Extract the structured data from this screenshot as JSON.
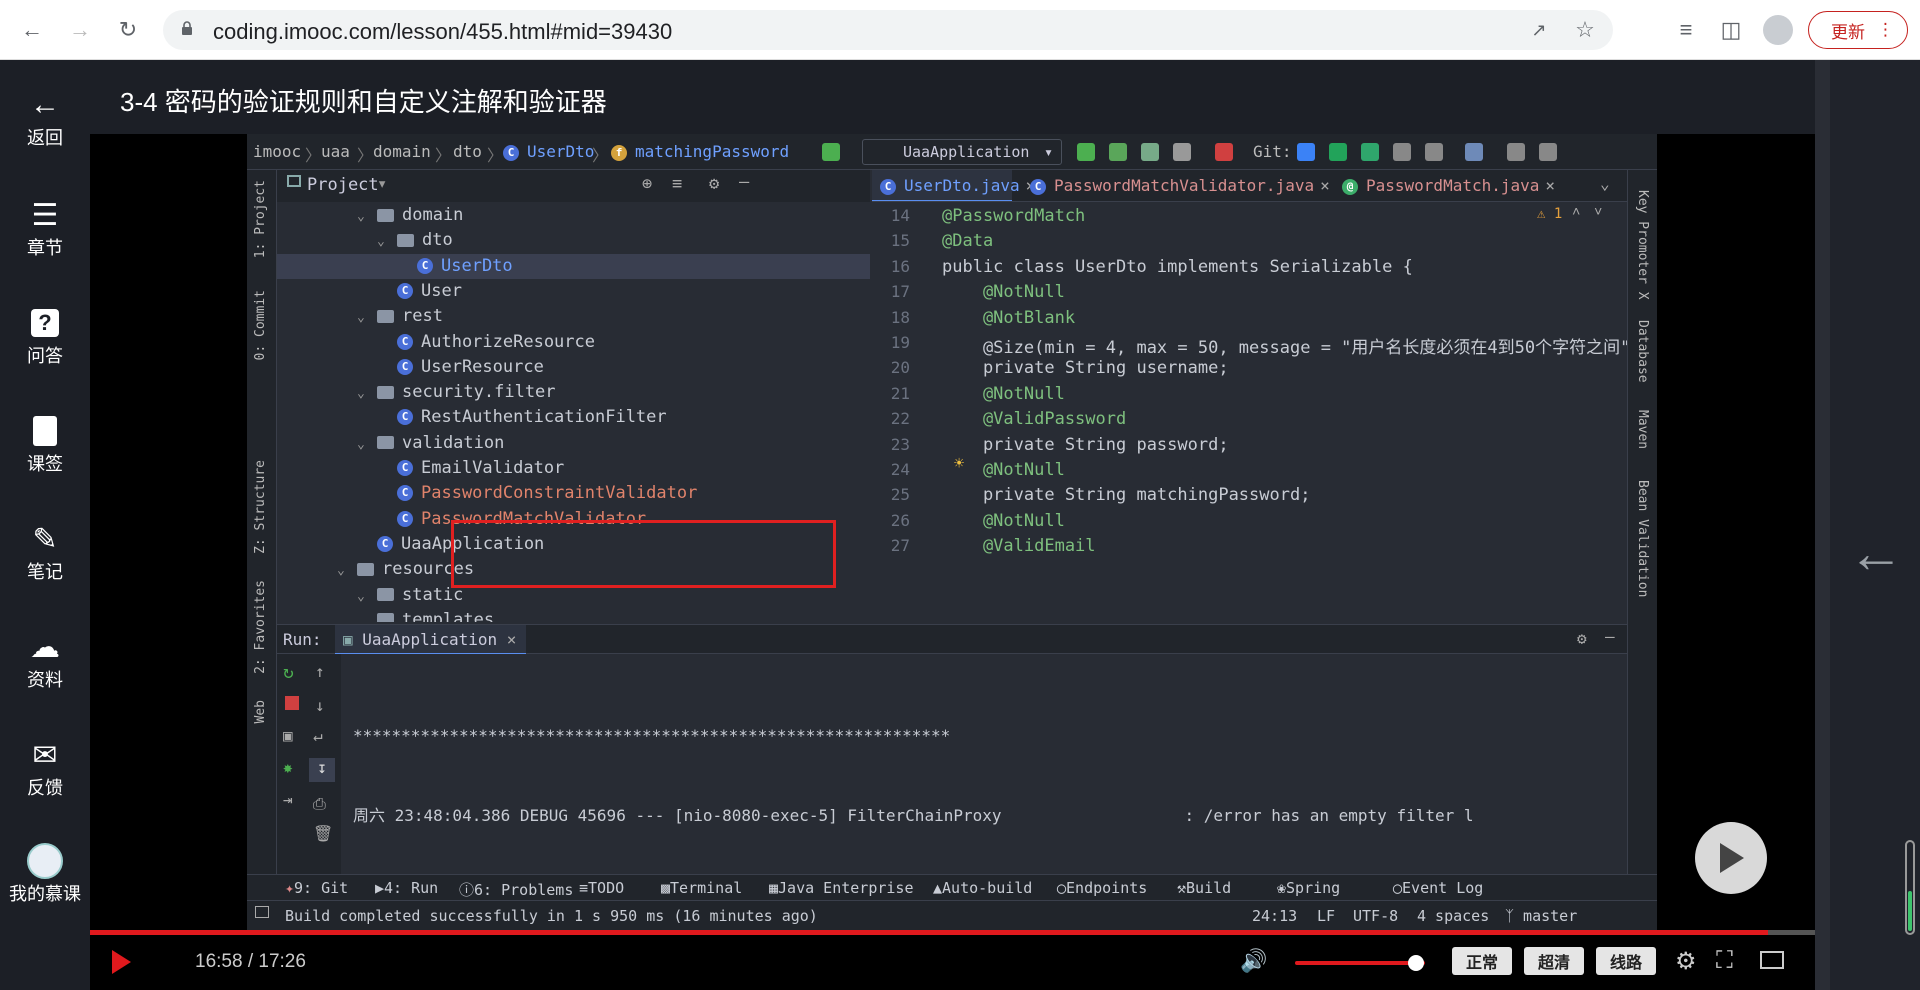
{
  "browser": {
    "url": "coding.imooc.com/lesson/455.html#mid=39430",
    "update_label": "更新"
  },
  "sidebar": {
    "items": [
      {
        "label": "返回",
        "icon": "arrow-left-icon"
      },
      {
        "label": "章节",
        "icon": "menu-icon"
      },
      {
        "label": "问答",
        "icon": "question-icon"
      },
      {
        "label": "课签",
        "icon": "bookmark-icon"
      },
      {
        "label": "笔记",
        "icon": "pencil-icon"
      },
      {
        "label": "资料",
        "icon": "cloud-download-icon"
      },
      {
        "label": "反馈",
        "icon": "mail-icon"
      },
      {
        "label": "我的慕课",
        "icon": "avatar-icon"
      }
    ]
  },
  "lesson_title": "3-4 密码的验证规则和自定义注解和验证器",
  "ide": {
    "breadcrumbs": [
      "imooc",
      "uaa",
      "domain",
      "dto",
      "UserDto",
      "matchingPassword"
    ],
    "run_config": "UaaApplication",
    "git_label": "Git:",
    "left_strip": [
      "1: Project",
      "0: Commit",
      "Z: Structure",
      "2: Favorites",
      "Web"
    ],
    "right_strip": [
      "Key Promoter X",
      "Database",
      "Maven",
      "Bean Validation"
    ],
    "project_label": "Project",
    "tree": [
      {
        "label": "domain",
        "kind": "folder",
        "indent": 5
      },
      {
        "label": "dto",
        "kind": "folder",
        "indent": 6
      },
      {
        "label": "UserDto",
        "kind": "class",
        "indent": 8,
        "selected": true
      },
      {
        "label": "User",
        "kind": "class",
        "indent": 7
      },
      {
        "label": "rest",
        "kind": "folder",
        "indent": 5
      },
      {
        "label": "AuthorizeResource",
        "kind": "class",
        "indent": 7
      },
      {
        "label": "UserResource",
        "kind": "class",
        "indent": 7
      },
      {
        "label": "security.filter",
        "kind": "folder",
        "indent": 5
      },
      {
        "label": "RestAuthenticationFilter",
        "kind": "class",
        "indent": 7
      },
      {
        "label": "validation",
        "kind": "folder",
        "indent": 5
      },
      {
        "label": "EmailValidator",
        "kind": "class",
        "indent": 7
      },
      {
        "label": "PasswordConstraintValidator",
        "kind": "class",
        "indent": 7,
        "highlight": true
      },
      {
        "label": "PasswordMatchValidator",
        "kind": "class",
        "indent": 7,
        "highlight": true
      },
      {
        "label": "UaaApplication",
        "kind": "class",
        "indent": 6
      },
      {
        "label": "resources",
        "kind": "folder",
        "indent": 4
      },
      {
        "label": "static",
        "kind": "folder",
        "indent": 5
      },
      {
        "label": "templates",
        "kind": "folder",
        "indent": 5
      }
    ],
    "tabs": [
      "UserDto.java",
      "PasswordMatchValidator.java",
      "PasswordMatch.java"
    ],
    "warning_count": "1",
    "code": [
      {
        "n": "14",
        "t": "@PasswordMatch",
        "c": "an"
      },
      {
        "n": "15",
        "t": "@Data",
        "c": "an"
      },
      {
        "n": "16",
        "t": "public class UserDto implements Serializable {",
        "c": "plain"
      },
      {
        "n": "17",
        "t": "    @NotNull",
        "c": "an"
      },
      {
        "n": "18",
        "t": "    @NotBlank",
        "c": "an"
      },
      {
        "n": "19",
        "t": "    @Size(min = 4, max = 50, message = \"用户名长度必须在4到50个字符之间\")",
        "c": "plain"
      },
      {
        "n": "20",
        "t": "    private String username;",
        "c": "plain"
      },
      {
        "n": "21",
        "t": "    @NotNull",
        "c": "an"
      },
      {
        "n": "22",
        "t": "    @ValidPassword",
        "c": "an"
      },
      {
        "n": "23",
        "t": "    private String password;",
        "c": "plain"
      },
      {
        "n": "24",
        "t": "    @NotNull",
        "c": "an"
      },
      {
        "n": "25",
        "t": "    private String matchingPassword;",
        "c": "plain"
      },
      {
        "n": "26",
        "t": "    @NotNull",
        "c": "an"
      },
      {
        "n": "27",
        "t": "    @ValidEmail",
        "c": "an"
      }
    ],
    "run_label": "Run:",
    "run_tab": "UaaApplication",
    "console_lines": [
      "**************************************************************",
      "周六 23:48:04.386 DEBUG 45696 --- [nio-8080-exec-5] FilterChainProxy                   : /error has an empty filter l"
    ],
    "tool_windows": [
      "9: Git",
      "4: Run",
      "6: Problems",
      "TODO",
      "Terminal",
      "Java Enterprise",
      "Auto-build",
      "Endpoints",
      "Build",
      "Spring",
      "Event Log"
    ],
    "status_message": "Build completed successfully in 1 s 950 ms (16 minutes ago)",
    "status_right": [
      "24:13",
      "LF",
      "UTF-8",
      "4 spaces",
      "master"
    ]
  },
  "player": {
    "time": "16:58 / 17:26",
    "progress": 0.973,
    "volume": 0.9,
    "quality_buttons": [
      "正常",
      "超清",
      "线路"
    ]
  }
}
